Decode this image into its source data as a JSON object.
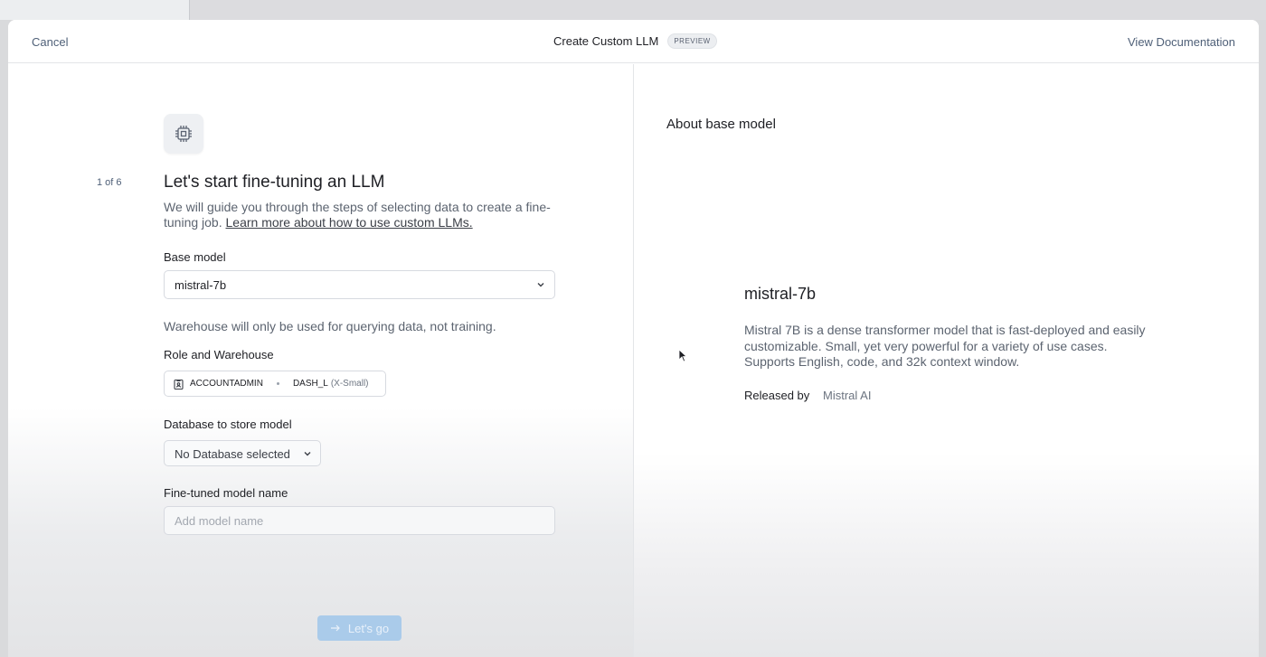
{
  "header": {
    "cancel_label": "Cancel",
    "title": "Create Custom LLM",
    "badge": "PREVIEW",
    "docs_label": "View Documentation"
  },
  "wizard": {
    "icon": "chip-icon",
    "step": "1 of 6",
    "title": "Let's start fine-tuning an LLM",
    "description": "We will guide you through the steps of selecting data to create a fine-tuning job.",
    "learn_more": "Learn more about how to use custom LLMs.",
    "base_model": {
      "label": "Base model",
      "value": "mistral-7b"
    },
    "warehouse_note": "Warehouse will only be used for querying data, not training.",
    "role_warehouse": {
      "label": "Role and Warehouse",
      "role": "ACCOUNTADMIN",
      "warehouse": "DASH_L",
      "size": "(X-Small)"
    },
    "database": {
      "label": "Database to store model",
      "value": "No Database selected"
    },
    "model_name": {
      "label": "Fine-tuned model name",
      "placeholder": "Add model name"
    },
    "submit_label": "Let's go"
  },
  "about": {
    "heading": "About base model",
    "model_name": "mistral-7b",
    "description": "Mistral 7B is a dense transformer model that is fast-deployed and easily customizable. Small, yet very powerful for a variety of use cases. Supports English, code, and 32k context window.",
    "released_label": "Released by",
    "released_value": "Mistral AI"
  },
  "colors": {
    "primary_disabled": "#aacbea",
    "link": "#4f6078"
  }
}
